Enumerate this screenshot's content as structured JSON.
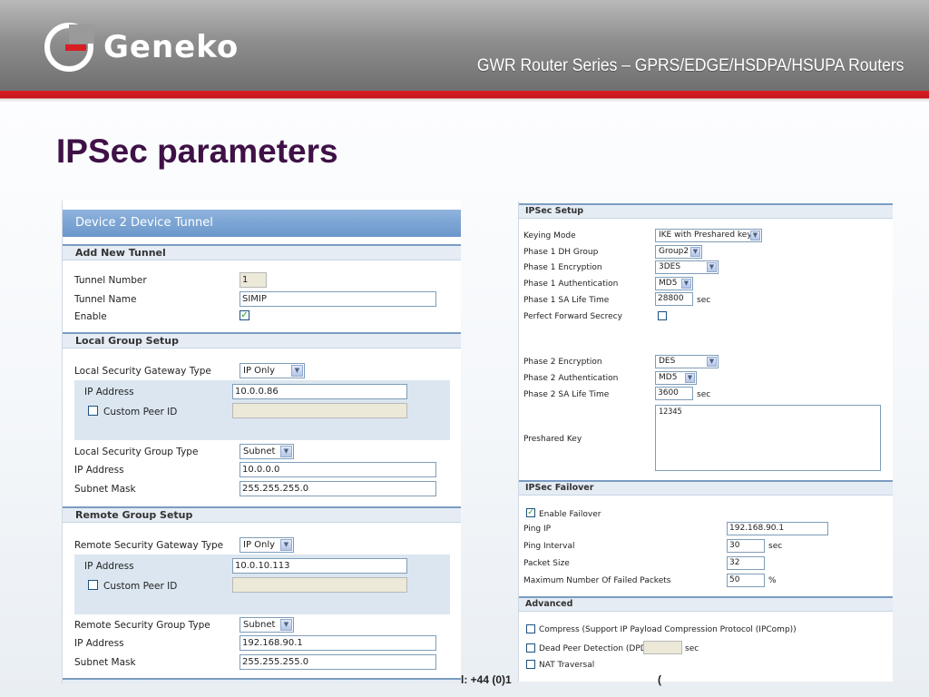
{
  "header": {
    "brand": "Geneko",
    "series_title": "GWR Router Series – GPRS/EDGE/HSDPA/HSUPA Routers",
    "accent": "#d91d24"
  },
  "slide": {
    "title": "IPSec parameters"
  },
  "footer": {
    "left": "l: +44 (0)1",
    "right": "("
  },
  "tunnel": {
    "title": "Device 2 Device Tunnel",
    "add_new": {
      "heading": "Add New Tunnel",
      "tunnel_number_label": "Tunnel Number",
      "tunnel_number": "1",
      "tunnel_name_label": "Tunnel Name",
      "tunnel_name": "SIMIP",
      "enable_label": "Enable",
      "enable_checked": true
    },
    "local": {
      "heading": "Local Group Setup",
      "gw_type_label": "Local Security Gateway Type",
      "gw_type": "IP Only",
      "ip_label": "IP Address",
      "ip": "10.0.0.86",
      "peer_id_label": "Custom Peer ID",
      "peer_id": "",
      "group_type_label": "Local Security Group Type",
      "group_type": "Subnet",
      "group_ip_label": "IP Address",
      "group_ip": "10.0.0.0",
      "mask_label": "Subnet Mask",
      "mask": "255.255.255.0"
    },
    "remote": {
      "heading": "Remote Group Setup",
      "gw_type_label": "Remote Security Gateway Type",
      "gw_type": "IP Only",
      "ip_label": "IP Address",
      "ip": "10.0.10.113",
      "peer_id_label": "Custom Peer ID",
      "peer_id": "",
      "group_type_label": "Remote Security Group Type",
      "group_type": "Subnet",
      "group_ip_label": "IP Address",
      "group_ip": "192.168.90.1",
      "mask_label": "Subnet Mask",
      "mask": "255.255.255.0"
    }
  },
  "ipsec": {
    "heading": "IPSec Setup",
    "keying_mode_label": "Keying Mode",
    "keying_mode": "IKE with Preshared key",
    "p1_dh_label": "Phase 1 DH Group",
    "p1_dh": "Group2",
    "p1_enc_label": "Phase 1 Encryption",
    "p1_enc": "3DES",
    "p1_auth_label": "Phase 1 Authentication",
    "p1_auth": "MD5",
    "p1_life_label": "Phase 1 SA Life Time",
    "p1_life": "28800",
    "sec": "sec",
    "pfs_label": "Perfect Forward Secrecy",
    "pfs_checked": false,
    "p2_enc_label": "Phase 2 Encryption",
    "p2_enc": "DES",
    "p2_auth_label": "Phase 2 Authentication",
    "p2_auth": "MD5",
    "p2_life_label": "Phase 2 SA Life Time",
    "p2_life": "3600",
    "psk_label": "Preshared Key",
    "psk": "12345"
  },
  "failover": {
    "heading": "IPSec Failover",
    "enable_label": "Enable Failover",
    "enable_checked": true,
    "ping_ip_label": "Ping IP",
    "ping_ip": "192.168.90.1",
    "ping_interval_label": "Ping Interval",
    "ping_interval": "30",
    "sec": "sec",
    "packet_size_label": "Packet Size",
    "packet_size": "32",
    "max_failed_label": "Maximum Number Of Failed Packets",
    "max_failed": "50",
    "percent": "%"
  },
  "advanced": {
    "heading": "Advanced",
    "compress_label": "Compress (Support IP Payload Compression Protocol (IPComp))",
    "dpd_label": "Dead Peer Detection (DPD)",
    "dpd_value": "",
    "sec": "sec",
    "nat_label": "NAT Traversal"
  }
}
